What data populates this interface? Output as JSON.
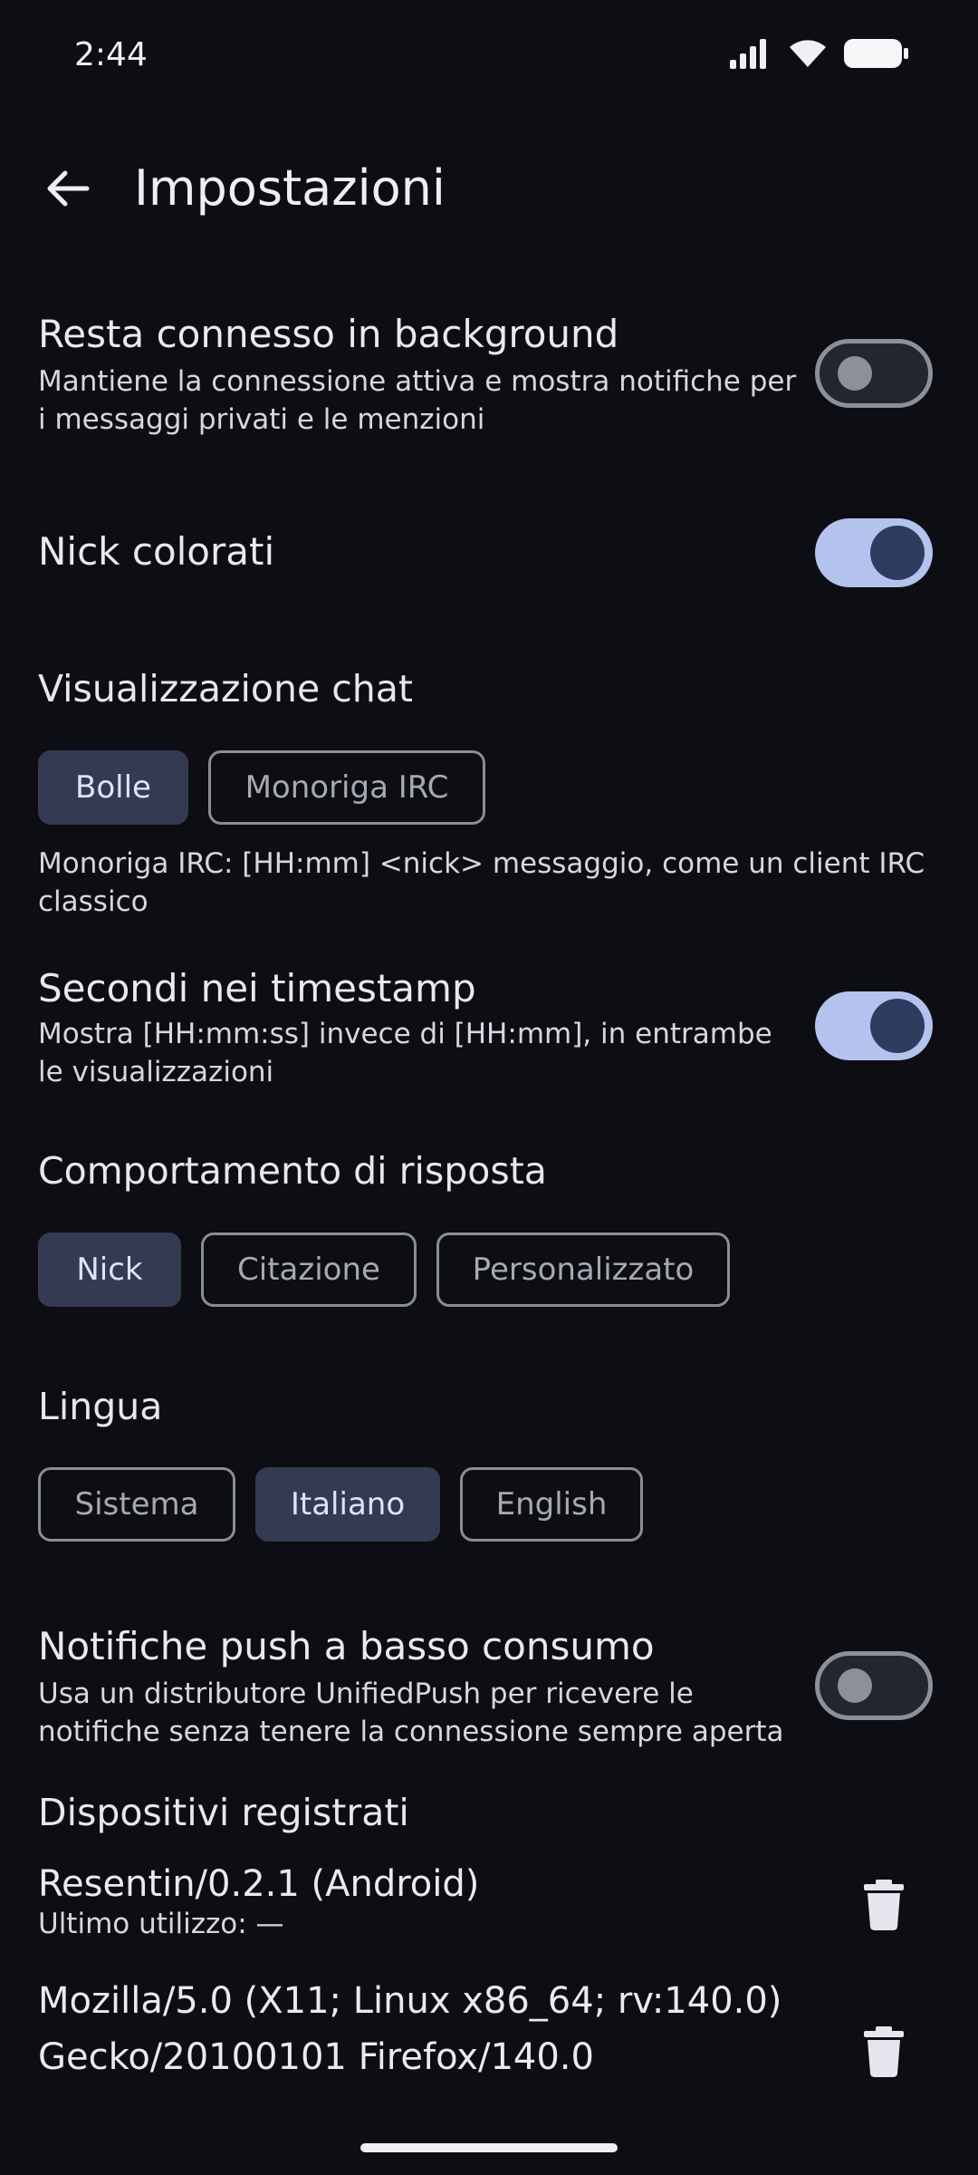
{
  "status_bar": {
    "time": "2:44"
  },
  "header": {
    "title": "Impostazioni"
  },
  "background": {
    "label": "Resta connesso in background",
    "description": "Mantiene la connessione attiva e mostra notifiche per i messaggi privati e le menzioni",
    "enabled": false
  },
  "colored_nicks": {
    "label": "Nick colorati",
    "enabled": true
  },
  "chat_view": {
    "title": "Visualizzazione chat",
    "options": [
      "Bolle",
      "Monoriga IRC"
    ],
    "selected": "Bolle",
    "note": "Monoriga IRC: [HH:mm] <nick> messaggio, come un client IRC classico"
  },
  "timestamp_seconds": {
    "label": "Secondi nei timestamp",
    "description": "Mostra [HH:mm:ss] invece di [HH:mm], in entrambe le visualizzazioni",
    "enabled": true
  },
  "reply_behavior": {
    "title": "Comportamento di risposta",
    "options": [
      "Nick",
      "Citazione",
      "Personalizzato"
    ],
    "selected": "Nick"
  },
  "language": {
    "title": "Lingua",
    "options": [
      "Sistema",
      "Italiano",
      "English"
    ],
    "selected": "Italiano"
  },
  "push": {
    "label": "Notifiche push a basso consumo",
    "description": "Usa un distributore UnifiedPush per ricevere le notifiche senza tenere la connessione sempre aperta",
    "enabled": false
  },
  "devices": {
    "title": "Dispositivi registrati",
    "items": [
      {
        "name": "Resentin/0.2.1 (Android)",
        "last_used": "Ultimo utilizzo: —"
      },
      {
        "name_line1": "Mozilla/5.0 (X11; Linux x86_64; rv:140.0)",
        "name_line2": "Gecko/20100101 Firefox/140.0"
      }
    ]
  }
}
